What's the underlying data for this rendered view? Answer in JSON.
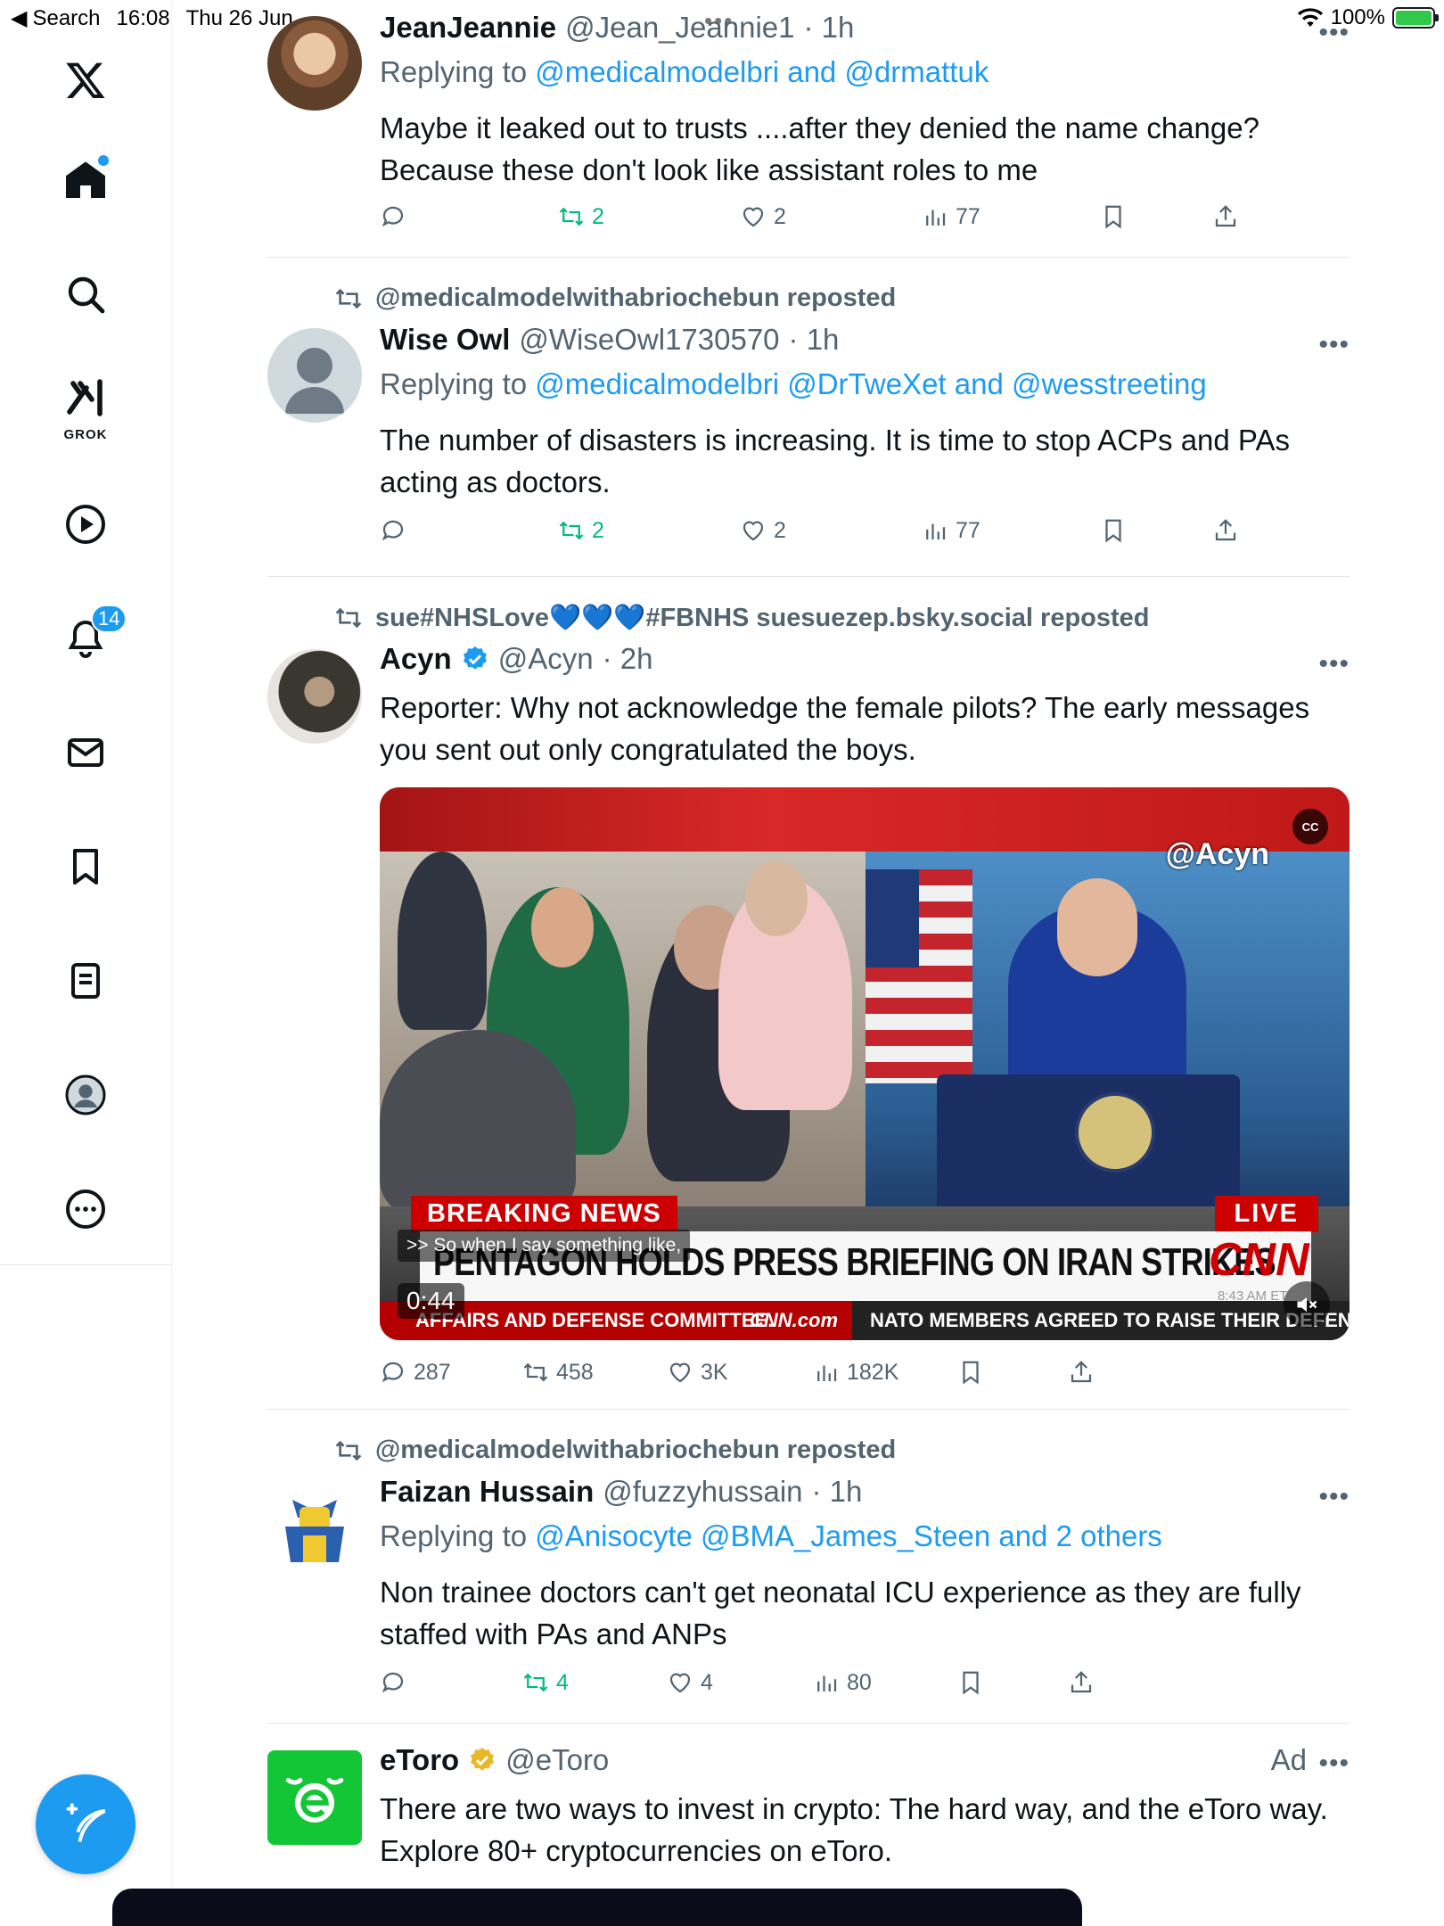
{
  "status_bar": {
    "back_label": "Search",
    "time": "16:08",
    "date": "Thu 26 Jun",
    "battery": "100%",
    "colors": {
      "battery_fill": "#32c84a"
    }
  },
  "sidebar": {
    "items": [
      {
        "name": "X logo",
        "icon": "x-logo-icon"
      },
      {
        "name": "Home",
        "icon": "home-icon",
        "has_dot": true
      },
      {
        "name": "Search",
        "icon": "search-icon"
      },
      {
        "name": "Grok",
        "icon": "grok-icon",
        "label": "GROK"
      },
      {
        "name": "Video",
        "icon": "play-icon"
      },
      {
        "name": "Notifications",
        "icon": "bell-icon",
        "badge": "14"
      },
      {
        "name": "Messages",
        "icon": "mail-icon"
      },
      {
        "name": "Bookmarks",
        "icon": "bookmark-icon"
      },
      {
        "name": "Lists",
        "icon": "list-icon"
      },
      {
        "name": "Profile",
        "icon": "profile-icon"
      },
      {
        "name": "More",
        "icon": "more-circle-icon"
      }
    ],
    "compose_icon": "compose-icon",
    "accent": "#1d9bf0"
  },
  "feed": {
    "tweets": [
      {
        "name": "JeanJeannie",
        "handle": "@Jean_Jeannie1",
        "time": "· 1h",
        "reply_prefix": "Replying to",
        "reply_to": "@medicalmodelbri and @drmattuk",
        "text": "Maybe it leaked out to trusts ....after they denied the name change? Because these don't look like assistant roles to me",
        "stats": {
          "replies": "",
          "reposts": "2",
          "likes": "2",
          "views": "77"
        }
      },
      {
        "reposted_by": "@medicalmodelwithabriochebun reposted",
        "name": "Wise Owl",
        "handle": "@WiseOwl1730570",
        "time": "· 1h",
        "reply_prefix": "Replying to",
        "reply_to": "@medicalmodelbri @DrTweXet and @wesstreeting",
        "text": "The number of disasters is increasing. It is time to stop ACPs and PAs acting as doctors.",
        "stats": {
          "replies": "",
          "reposts": "2",
          "likes": "2",
          "views": "77"
        }
      },
      {
        "reposted_by": "sue#NHSLove💙💙💙#FBNHS suesuezep.bsky.social reposted",
        "name": "Acyn",
        "handle": "@Acyn",
        "time": "· 2h",
        "text": "Reporter: Why not acknowledge the female pilots? The early messages you sent out only congratulated the boys.",
        "video": {
          "breaking": "BREAKING NEWS",
          "live": "LIVE",
          "headline": "PENTAGON HOLDS PRESS BRIEFING ON IRAN STRIKES",
          "network": "CNN",
          "network_time": "8:43 AM ET",
          "caption": ">> So when I say something like,",
          "duration": "0:44",
          "ticker_left": "AFFAIRS AND DEFENSE COMMITTEE.",
          "ticker_site": "CNN.com",
          "ticker_right": "NATO MEMBERS AGREED TO RAISE THEIR DEFENSE SPENDING",
          "watermark": "@Acyn",
          "cc": "CC"
        },
        "stats": {
          "replies": "287",
          "reposts": "458",
          "likes": "3K",
          "views": "182K"
        }
      },
      {
        "reposted_by": "@medicalmodelwithabriochebun reposted",
        "name": "Faizan Hussain",
        "handle": "@fuzzyhussain",
        "time": "· 1h",
        "reply_prefix": "Replying to",
        "reply_to": "@Anisocyte @BMA_James_Steen and 2 others",
        "text": "Non trainee doctors can't get neonatal ICU experience as they are fully staffed with PAs and ANPs",
        "stats": {
          "replies": "",
          "reposts": "4",
          "likes": "4",
          "views": "80"
        }
      },
      {
        "name": "eToro",
        "handle": "@eToro",
        "ad_label": "Ad",
        "text": "There are two ways to invest in crypto: The hard way, and the eToro way. Explore 80+ cryptocurrencies on eToro."
      }
    ]
  },
  "colors": {
    "link": "#1d9bf0",
    "muted": "#536471",
    "repost_green": "#00ba7c",
    "verified_blue": "#1d9bf0",
    "verified_gold": "#e8b829"
  }
}
